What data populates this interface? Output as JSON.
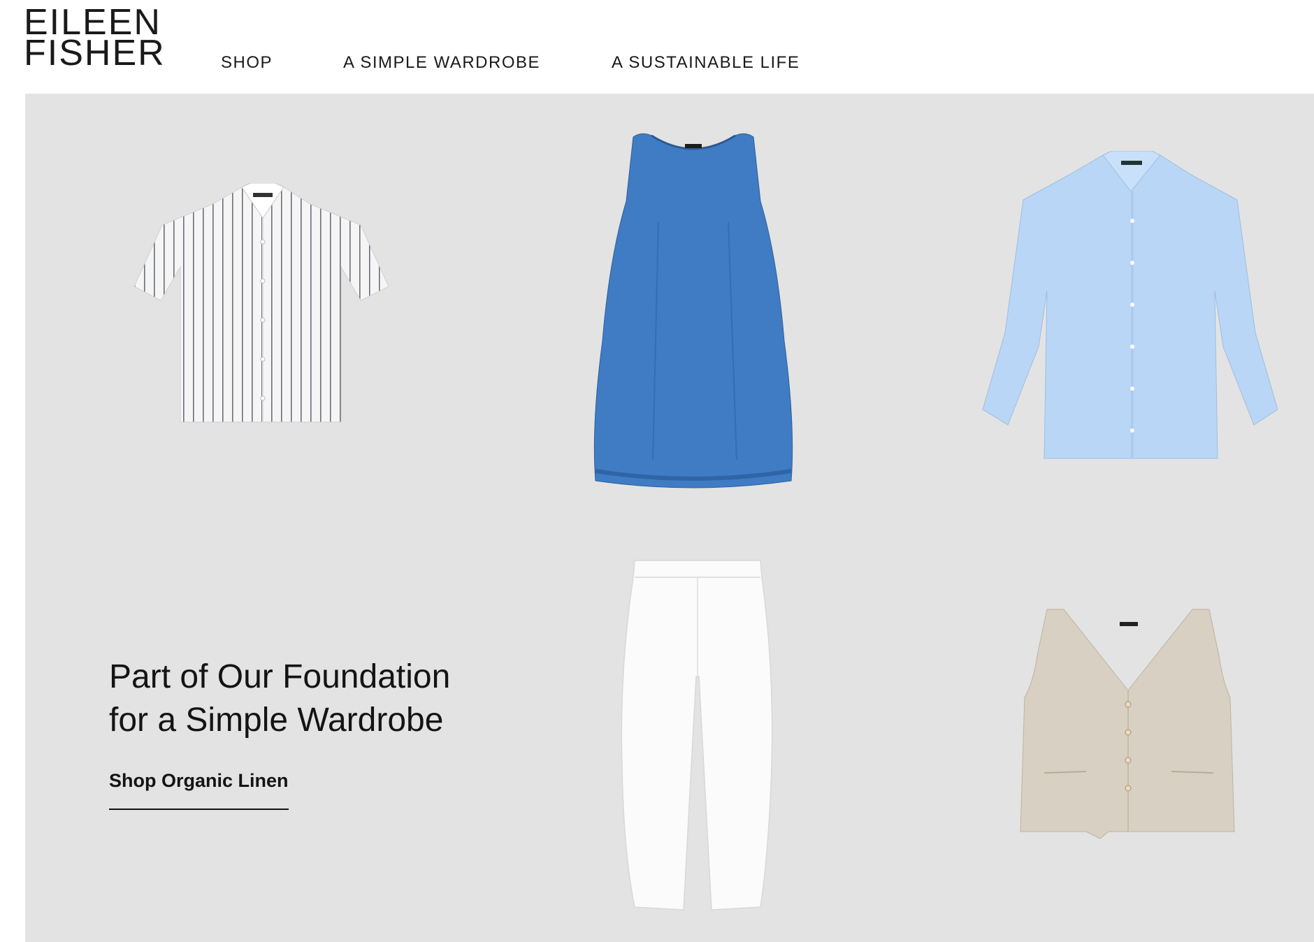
{
  "brand": {
    "line1": "EILEEN",
    "line2": "FISHER"
  },
  "nav": {
    "items": [
      "SHOP",
      "A SIMPLE WARDROBE",
      "A SUSTAINABLE LIFE"
    ]
  },
  "hero": {
    "headline_line1": "Part of Our Foundation",
    "headline_line2": "for a Simple Wardrobe",
    "cta_label": "Shop Organic Linen",
    "background": "#e3e3e3"
  },
  "products": [
    {
      "name": "striped short-sleeve shirt",
      "color": "#f4f4f4"
    },
    {
      "name": "blue sleeveless dress",
      "color": "#3d78c0"
    },
    {
      "name": "light blue long-sleeve shirt",
      "color": "#b9d5f5"
    },
    {
      "name": "white trousers",
      "color": "#fbfbfb"
    },
    {
      "name": "natural linen vest",
      "color": "#d8d0c2"
    }
  ]
}
